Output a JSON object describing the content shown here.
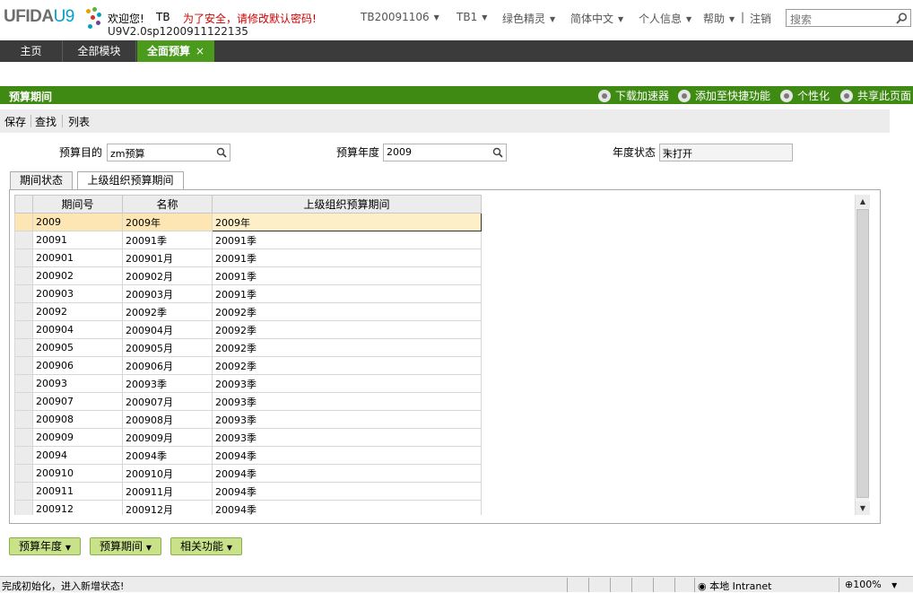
{
  "header": {
    "logo_text": "UFIDA",
    "logo_u9": "U9",
    "welcome": "欢迎您!",
    "user": "TB",
    "security_warning": "为了安全，请修改默认密码!",
    "version": "U9V2.0sp1200911122135",
    "nav": [
      "TB20091106",
      "TB1",
      "绿色精灵",
      "简体中文",
      "个人信息",
      "帮助",
      "注销"
    ],
    "search_placeholder": "搜索"
  },
  "tabs": {
    "home": "主页",
    "all_modules": "全部模块",
    "active": "全面预算",
    "close": "×"
  },
  "titlebar": {
    "title": "预算期间",
    "actions": [
      "下载加速器",
      "添加至快捷功能",
      "个性化",
      "共享此页面"
    ]
  },
  "toolbar": [
    "保存",
    "查找",
    "列表"
  ],
  "form": {
    "purpose_label": "预算目的",
    "purpose_value": "zm预算",
    "year_label": "预算年度",
    "year_value": "2009",
    "status_label": "年度状态",
    "status_value": "未打开"
  },
  "subtabs": [
    "期间状态",
    "上级组织预算期间"
  ],
  "grid": {
    "columns": [
      "期间号",
      "名称",
      "上级组织预算期间"
    ],
    "rows": [
      [
        "2009",
        "2009年",
        "2009年"
      ],
      [
        "20091",
        "20091季",
        "20091季"
      ],
      [
        "200901",
        "200901月",
        "20091季"
      ],
      [
        "200902",
        "200902月",
        "20091季"
      ],
      [
        "200903",
        "200903月",
        "20091季"
      ],
      [
        "20092",
        "20092季",
        "20092季"
      ],
      [
        "200904",
        "200904月",
        "20092季"
      ],
      [
        "200905",
        "200905月",
        "20092季"
      ],
      [
        "200906",
        "200906月",
        "20092季"
      ],
      [
        "20093",
        "20093季",
        "20093季"
      ],
      [
        "200907",
        "200907月",
        "20093季"
      ],
      [
        "200908",
        "200908月",
        "20093季"
      ],
      [
        "200909",
        "200909月",
        "20093季"
      ],
      [
        "20094",
        "20094季",
        "20094季"
      ],
      [
        "200910",
        "200910月",
        "20094季"
      ],
      [
        "200911",
        "200911月",
        "20094季"
      ],
      [
        "200912",
        "200912月",
        "20094季"
      ]
    ]
  },
  "bottom_buttons": [
    "预算年度",
    "预算期间",
    "相关功能"
  ],
  "statusbar": {
    "message": "完成初始化，进入新增状态!",
    "zone": "本地 Intranet",
    "zoom": "100%"
  }
}
